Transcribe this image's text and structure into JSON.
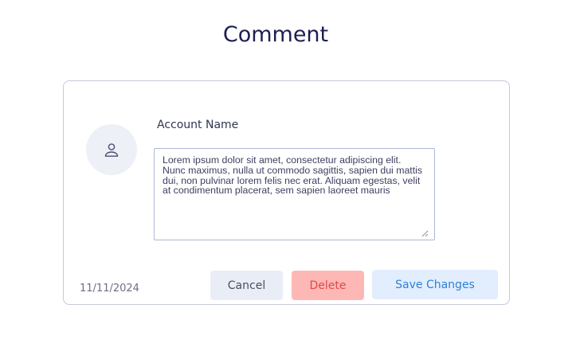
{
  "page": {
    "title": "Comment"
  },
  "comment": {
    "account_name": "Account Name",
    "avatar_icon": "user-icon",
    "text": "Lorem ipsum dolor sit amet, consectetur adipiscing elit. Nunc maximus, nulla ut commodo sagittis, sapien dui mattis dui, non pulvinar lorem felis nec erat. Aliquam egestas, velit at condimentum placerat, sem sapien laoreet mauris",
    "date": "11/11/2024"
  },
  "actions": {
    "cancel_label": "Cancel",
    "delete_label": "Delete",
    "save_label": "Save Changes"
  },
  "colors": {
    "title": "#1d1f4f",
    "card_border": "#c5c9da",
    "avatar_bg": "#edf0f6",
    "cancel_bg": "#e9edf5",
    "delete_bg": "#fdb8b6",
    "delete_text": "#e4474a",
    "save_bg": "#e2eefd",
    "save_text": "#2f7fd8"
  }
}
